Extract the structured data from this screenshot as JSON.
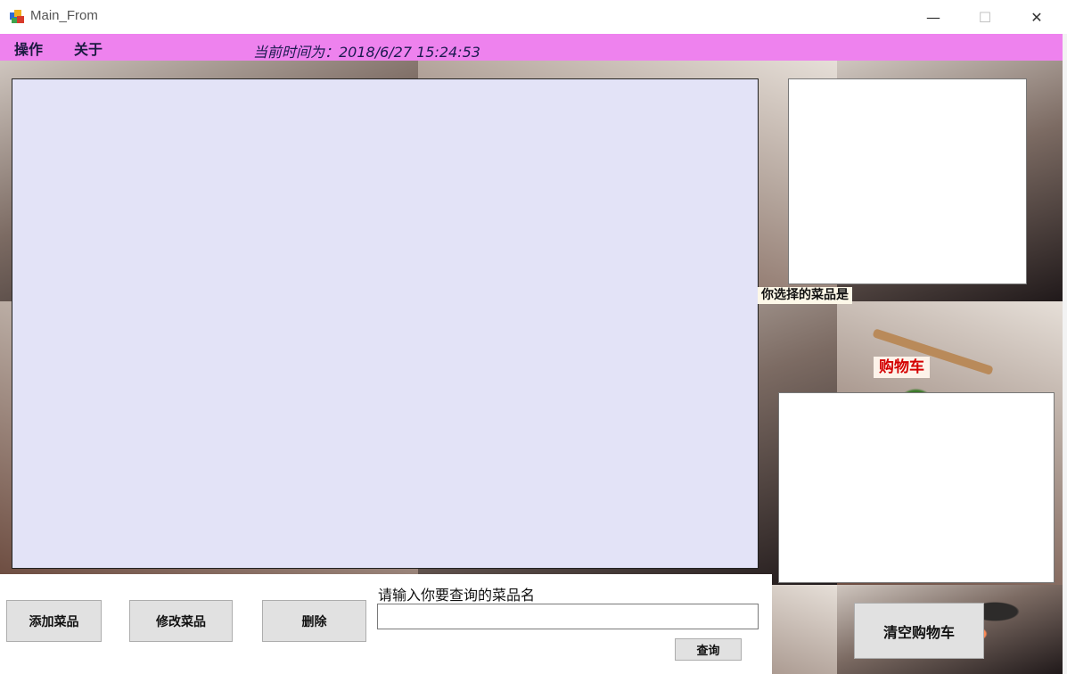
{
  "window": {
    "title": "Main_From",
    "minimize_glyph": "—",
    "maximize_glyph": "☐",
    "close_glyph": "✕"
  },
  "menu": {
    "items": [
      "操作",
      "关于"
    ],
    "clock_text": "当前时间为：2018/6/27 15:24:53",
    "background_color": "#ee82ee"
  },
  "labels": {
    "selected_dish": "你选择的菜品是",
    "cart": "购物车",
    "search_prompt": "请输入你要查询的菜品名"
  },
  "buttons": {
    "add": "添加菜品",
    "edit": "修改菜品",
    "delete": "删除",
    "search": "查询",
    "clear_cart": "清空购物车"
  },
  "search": {
    "value": "",
    "placeholder": ""
  },
  "icons": {
    "app": "app-window-icon"
  }
}
